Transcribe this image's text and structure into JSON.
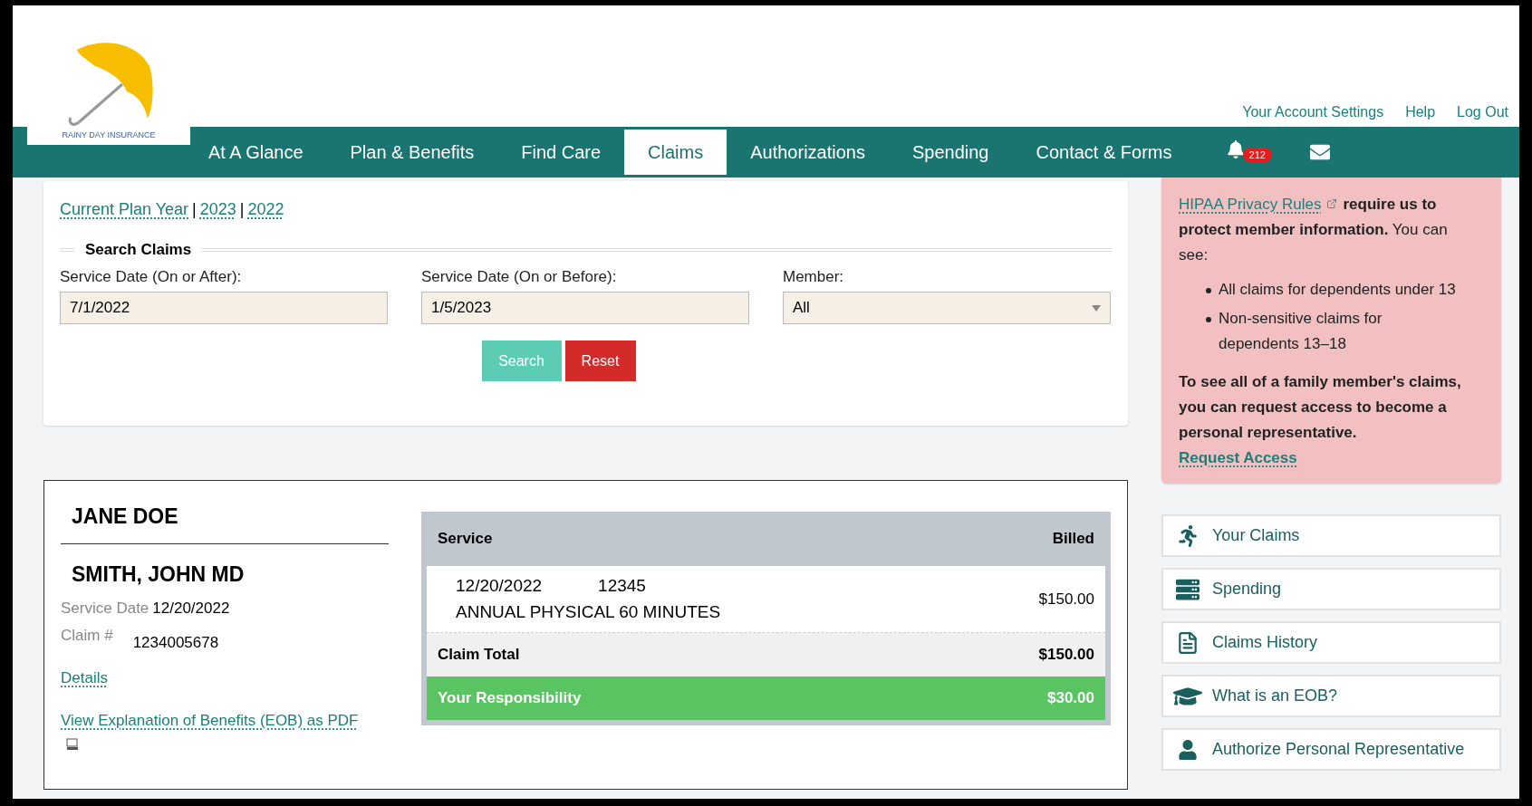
{
  "logo": {
    "text": "RAINY DAY INSURANCE"
  },
  "account_links": [
    "Your Account Settings",
    "Help",
    "Log Out"
  ],
  "nav": {
    "items": [
      {
        "label": "At A Glance",
        "selected": false
      },
      {
        "label": "Plan & Benefits",
        "selected": false
      },
      {
        "label": "Find Care",
        "selected": false
      },
      {
        "label": "Claims",
        "selected": true
      },
      {
        "label": "Authorizations",
        "selected": false
      },
      {
        "label": "Spending",
        "selected": false
      },
      {
        "label": "Contact & Forms",
        "selected": false
      }
    ],
    "notification_count": "212"
  },
  "plan_years": [
    "Current Plan Year",
    "2023",
    "2022"
  ],
  "plan_year_separator": "|",
  "search": {
    "title": "Search Claims",
    "fields": [
      {
        "kind": "text",
        "label": "Service Date (On or After):",
        "value": "7/1/2022"
      },
      {
        "kind": "text",
        "label": "Service Date (On or Before):",
        "value": "1/5/2023"
      },
      {
        "kind": "select",
        "label": "Member:",
        "value": "All"
      }
    ],
    "buttons": [
      {
        "kind": "primary",
        "label": "Search"
      },
      {
        "kind": "danger",
        "label": "Reset"
      }
    ]
  },
  "claim": {
    "member": "JANE DOE",
    "provider": "SMITH, JOHN MD",
    "service_date_label": "Service Date",
    "service_date": "12/20/2022",
    "claim_label": "Claim #",
    "claim_number": "1234005678",
    "details_link": "Details",
    "eob_link": "View Explanation of Benefits (EOB) as PDF",
    "table": {
      "columns": [
        "Service",
        "Billed"
      ],
      "rows": [
        {
          "date": "12/20/2022",
          "code": "12345",
          "description": "ANNUAL PHYSICAL 60 MINUTES",
          "billed": "$150.00"
        }
      ],
      "total_label": "Claim Total",
      "total": "$150.00",
      "responsibility_label": "Your Responsibility",
      "responsibility": "$30.00"
    }
  },
  "notice": {
    "link": "HIPAA Privacy Rules",
    "text": "**require us to protect member information.** You can see:",
    "bullets": [
      "All claims for dependents under 13",
      "Non-sensitive claims for dependents 13–18"
    ],
    "bold_text": "To see all of a family member's claims, you can request access to become a personal representative.",
    "action_link": "Request Access"
  },
  "quick_links": [
    {
      "kind": "runner",
      "label": "Your Claims"
    },
    {
      "kind": "server",
      "label": "Spending"
    },
    {
      "kind": "document",
      "label": "Claims History"
    },
    {
      "kind": "cap",
      "label": "What is an EOB?"
    },
    {
      "kind": "user",
      "label": "Authorize Personal Representative"
    }
  ]
}
